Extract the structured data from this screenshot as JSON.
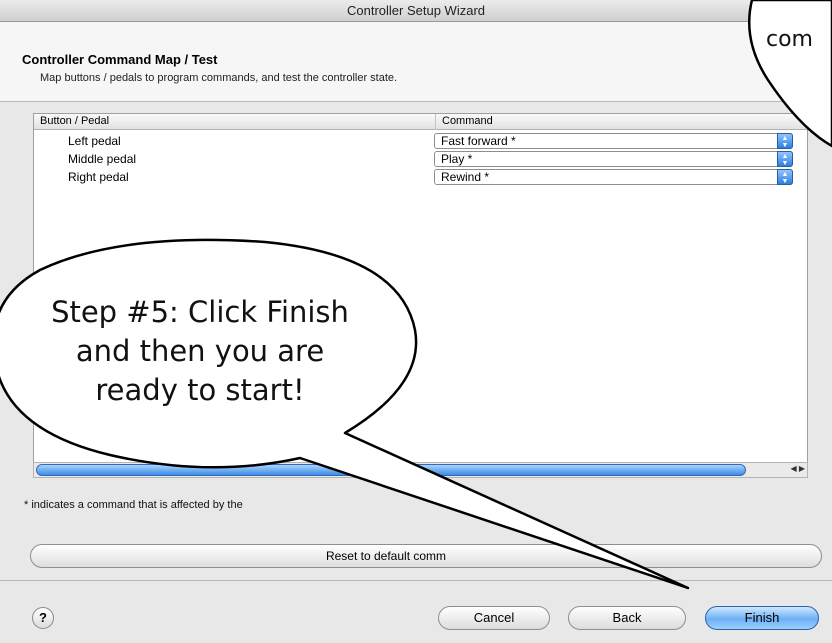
{
  "window": {
    "title": "Controller Setup Wizard"
  },
  "header": {
    "title": "Controller Command Map / Test",
    "subtitle": "Map buttons / pedals to program commands, and test the controller state."
  },
  "table": {
    "columns": [
      "Button / Pedal",
      "Command"
    ],
    "rows": [
      {
        "button": "Left pedal",
        "command": "Fast forward *"
      },
      {
        "button": "Middle pedal",
        "command": "Play *"
      },
      {
        "button": "Right pedal",
        "command": "Rewind *"
      }
    ]
  },
  "footnote": "* indicates a command that is affected by the",
  "reset_label": "Reset to default comm",
  "buttons": {
    "help": "?",
    "cancel": "Cancel",
    "back": "Back",
    "finish": "Finish"
  },
  "callouts": {
    "main": [
      "Step #5: Click Finish",
      "and then you are",
      "ready to start!"
    ],
    "partial": "com"
  },
  "colors": {
    "accent": "#4a9be8",
    "header_bg": "#f6f6f6",
    "window_bg": "#e8e8e8"
  }
}
